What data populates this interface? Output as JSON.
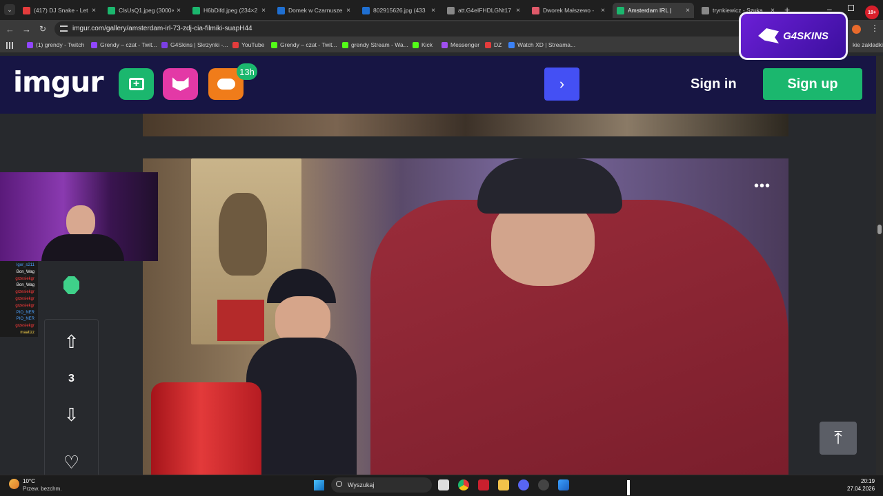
{
  "browser": {
    "tabs": [
      {
        "label": "(417) DJ Snake - Let",
        "color": "#e43c3c"
      },
      {
        "label": "ClsUsQ1.jpeg (3000×",
        "color": "#1bb76e"
      },
      {
        "label": "H6bDifd.jpeg (234×2",
        "color": "#1bb76e"
      },
      {
        "label": "Domek w Czarnusze",
        "color": "#1f6fd1"
      },
      {
        "label": "802915626.jpg (433",
        "color": "#1f6fd1"
      },
      {
        "label": "att.G4eIFHDLGNt17",
        "color": "#888888"
      },
      {
        "label": "Dworek Małszewo -",
        "color": "#e05a6a"
      },
      {
        "label": "Amsterdam IRL |",
        "color": "#1bb76e"
      },
      {
        "label": "trynkiewicz - Szuka",
        "color": "#888888"
      }
    ],
    "url": "imgur.com/gallery/amsterdam-irl-73-zdj-cia-filmiki-suapH44",
    "bookmarks": [
      {
        "label": "(1) grendy - Twitch",
        "color": "#9146ff"
      },
      {
        "label": "Grendy – czat - Twit...",
        "color": "#9146ff"
      },
      {
        "label": "G4Skins | Skrzynki -...",
        "color": "#7b3fe4"
      },
      {
        "label": "YouTube",
        "color": "#e43c3c"
      },
      {
        "label": "Grendy – czat - Twit...",
        "color": "#53fc18"
      },
      {
        "label": "grendy Stream - Wa...",
        "color": "#53fc18"
      },
      {
        "label": "Kick",
        "color": "#53fc18"
      },
      {
        "label": "Messenger",
        "color": "#a04ff0"
      },
      {
        "label": "DZ",
        "color": "#e43c3c"
      },
      {
        "label": "Watch XD | Streama...",
        "color": "#3b82f6"
      }
    ],
    "bookmarks_overflow": "kie zakładki",
    "profile_badge": "18+"
  },
  "overlay": {
    "g4skins_label": "G4SKINS"
  },
  "imgur": {
    "logo": "imgur",
    "badge": "13h",
    "next_glyph": "›",
    "signin": "Sign in",
    "signup": "Sign up",
    "vote_count": "3",
    "more_glyph": "•••",
    "to_top_glyph": "⤒"
  },
  "chat": [
    {
      "name": "Igor_s211",
      "color": "#4da3ff"
    },
    {
      "name": "Bon_Wag",
      "color": "#ffffff"
    },
    {
      "name": "grzesiekgr",
      "color": "#ff3b3b"
    },
    {
      "name": "Bon_Wag",
      "color": "#ffffff"
    },
    {
      "name": "grzesiekgr",
      "color": "#ff3b3b"
    },
    {
      "name": "grzesiekgr",
      "color": "#ff3b3b"
    },
    {
      "name": "grzesiekgr",
      "color": "#ff3b3b"
    },
    {
      "name": "PIO_NER",
      "color": "#4da3ff"
    },
    {
      "name": "PIO_NER",
      "color": "#4da3ff"
    },
    {
      "name": "grzesiekgr",
      "color": "#ff3b3b"
    },
    {
      "name": "maatizz",
      "color": "#ffd84d"
    }
  ],
  "taskbar": {
    "weather_temp": "10°C",
    "weather_desc": "Przew. bezchm.",
    "search_label": "Wyszukaj",
    "time": "20:19",
    "date": "27.04.2026"
  }
}
